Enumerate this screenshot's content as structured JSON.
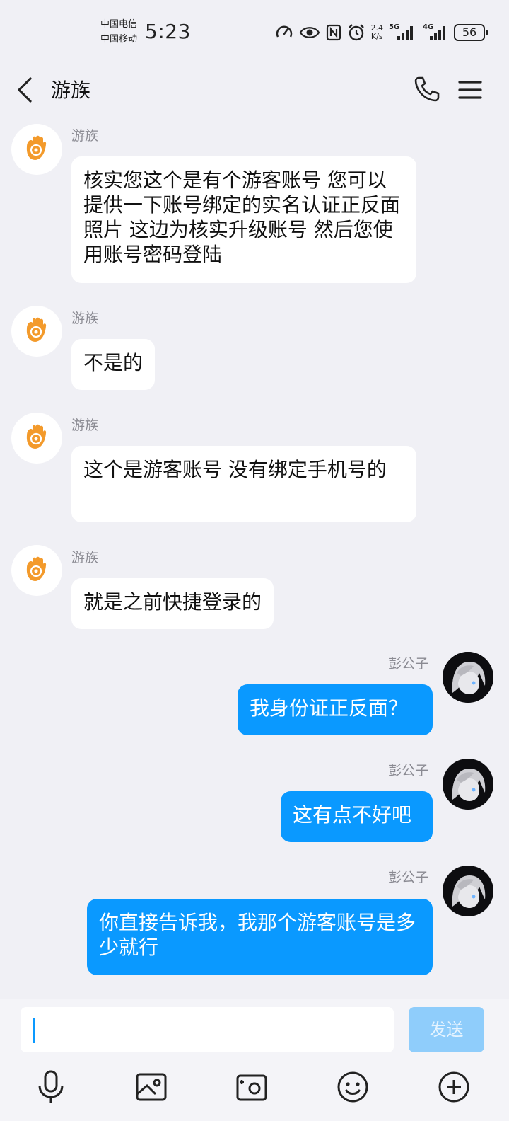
{
  "status_bar": {
    "carrier_1": "中国电信",
    "carrier_2": "中国移动",
    "time": "5:23",
    "net_speed_value": "2.4",
    "net_speed_unit": "K/s",
    "network_1": "5G",
    "network_2": "4G",
    "battery": "56"
  },
  "header": {
    "title": "游族"
  },
  "messages": [
    {
      "side": "left",
      "sender": "游族",
      "text": "核实您这个是有个游客账号  您可以提供一下账号绑定的实名认证正反面照片  这边为核实升级账号 然后您使用账号密码登陆"
    },
    {
      "side": "left",
      "sender": "游族",
      "text": "不是的"
    },
    {
      "side": "left",
      "sender": "游族",
      "text": "这个是游客账号  没有绑定手机号的"
    },
    {
      "side": "left",
      "sender": "游族",
      "text": "就是之前快捷登录的"
    },
    {
      "side": "right",
      "sender": "彭公子",
      "text": "我身份证正反面？"
    },
    {
      "side": "right",
      "sender": "彭公子",
      "text": "这有点不好吧"
    },
    {
      "side": "right",
      "sender": "彭公子",
      "text": "你直接告诉我，我那个游客账号是多少就行"
    }
  ],
  "input": {
    "value": "",
    "send_label": "发送"
  },
  "colors": {
    "outgoing_bubble": "#0a99ff",
    "incoming_bubble": "#ffffff",
    "background": "#f0f0f5",
    "send_disabled": "#8fcdfb",
    "brand_orange": "#f39a2b"
  }
}
